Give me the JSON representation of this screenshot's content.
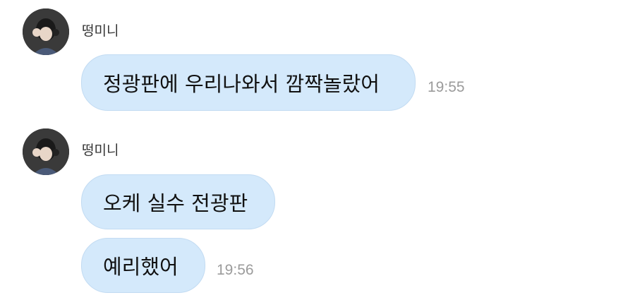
{
  "messages": [
    {
      "sender": "떵미니",
      "bubbles": [
        {
          "text": "정광판에 우리나와서 깜짝놀랐어",
          "time": "19:55"
        }
      ]
    },
    {
      "sender": "떵미니",
      "bubbles": [
        {
          "text": "오케 실수 전광판",
          "time": ""
        },
        {
          "text": "예리했어",
          "time": "19:56"
        }
      ]
    }
  ],
  "colors": {
    "bubble": "#d4e9fb",
    "bubble_border": "#c2dbf2",
    "time": "#9b9b9b",
    "sender": "#333333"
  },
  "icons": [
    "avatar"
  ]
}
